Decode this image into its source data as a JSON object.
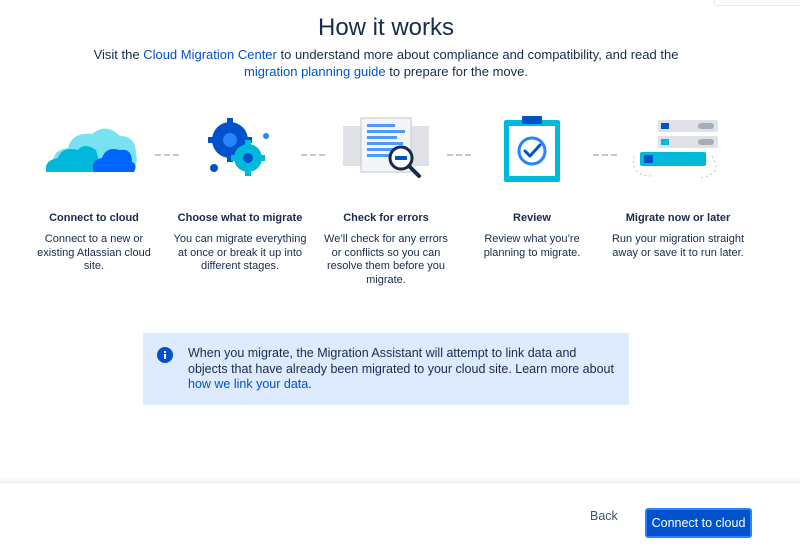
{
  "header": {
    "title": "How it works",
    "intro_prefix": "Visit the ",
    "intro_link1": "Cloud Migration Center",
    "intro_mid": " to understand more about compliance and compatibility, and read the ",
    "intro_link2": "migration planning guide",
    "intro_suffix": " to prepare for the move."
  },
  "steps": [
    {
      "title": "Connect to cloud",
      "desc": "Connect to a new or existing Atlassian cloud site.",
      "icon": "cloud-icon"
    },
    {
      "title": "Choose what to migrate",
      "desc": "You can migrate everything at once or break it up into different stages.",
      "icon": "gears-icon"
    },
    {
      "title": "Check for errors",
      "desc": "We’ll check for any errors or conflicts so you can resolve them before you migrate.",
      "icon": "magnifier-documents-icon"
    },
    {
      "title": "Review",
      "desc": "Review what you’re planning to migrate.",
      "icon": "clipboard-check-icon"
    },
    {
      "title": "Migrate now or later",
      "desc": "Run your migration straight away or save it to run later.",
      "icon": "list-schedule-icon"
    }
  ],
  "info": {
    "text": "When you migrate, the Migration Assistant will attempt to link data and objects that have already been migrated to your cloud site. Learn more about ",
    "link": "how we link your data",
    "suffix": "."
  },
  "footer": {
    "back_label": "Back",
    "primary_label": "Connect to cloud"
  },
  "colors": {
    "primary": "#0052cc",
    "info_bg": "#deebff",
    "text": "#172b4d"
  }
}
